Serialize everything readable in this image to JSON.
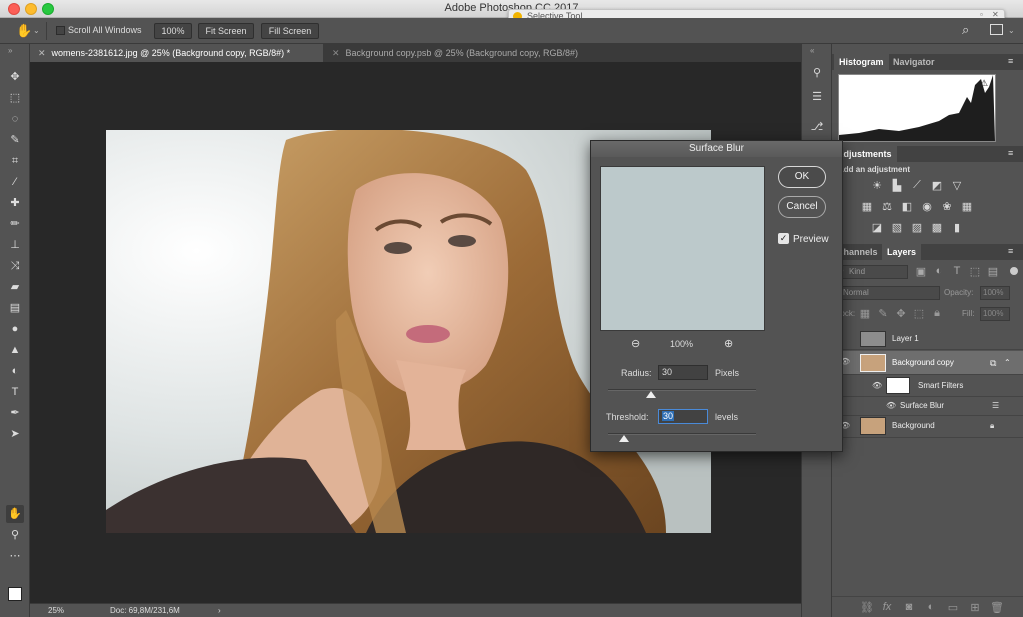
{
  "window": {
    "title": "Adobe Photoshop CC 2017"
  },
  "selective_tool": {
    "title": "Selective Tool"
  },
  "options_bar": {
    "scroll_all_windows": "Scroll All Windows",
    "zoom_100": "100%",
    "fit_screen": "Fit Screen",
    "fill_screen": "Fill Screen"
  },
  "tabs": [
    {
      "label": "womens-2381612.jpg @ 25% (Background copy, RGB/8#) *",
      "active": true
    },
    {
      "label": "Background copy.psb @ 25% (Background copy, RGB/8#)",
      "active": false
    }
  ],
  "status": {
    "zoom": "25%",
    "doc": "Doc: 69,8M/231,6M"
  },
  "dialog": {
    "title": "Surface Blur",
    "ok": "OK",
    "cancel": "Cancel",
    "preview_label": "Preview",
    "preview_checked": true,
    "zoom": "100%",
    "radius_label": "Radius:",
    "radius_value": "30",
    "radius_unit": "Pixels",
    "radius_fraction": 0.29,
    "threshold_label": "Threshold:",
    "threshold_value": "30",
    "threshold_unit": "levels",
    "threshold_fraction": 0.11
  },
  "panels": {
    "histogram_tabs": [
      "Histogram",
      "Navigator"
    ],
    "adjustments": {
      "tab": "Adjustments",
      "subtitle": "Add an adjustment"
    },
    "layers_tabs": [
      "Channels",
      "Layers"
    ],
    "kind_label": "Kind",
    "blend_mode": "Normal",
    "opacity_label": "Opacity:",
    "opacity_value": "100%",
    "lock_label": "Lock:",
    "fill_label": "Fill:",
    "fill_value": "100%",
    "layers": [
      {
        "name": "Layer 1"
      },
      {
        "name": "Background copy"
      },
      {
        "name": "Smart Filters"
      },
      {
        "name": "Surface Blur"
      },
      {
        "name": "Background"
      }
    ]
  },
  "colors": {
    "ui_panel": "#535353",
    "canvas": "#282828",
    "preview": "#bcc9cb",
    "selection": "#2f6fb5"
  }
}
